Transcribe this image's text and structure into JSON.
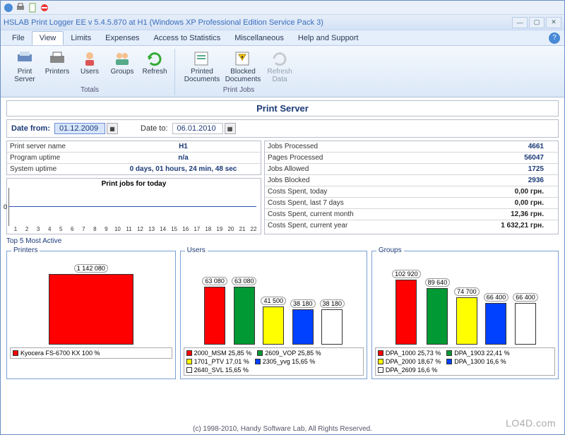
{
  "title": "HSLAB Print Logger EE v 5.4.5.870 at H1 (Windows XP Professional Edition Service Pack 3)",
  "menu": {
    "file": "File",
    "view": "View",
    "limits": "Limits",
    "expenses": "Expenses",
    "access": "Access to Statistics",
    "misc": "Miscellaneous",
    "help": "Help and Support"
  },
  "ribbon": {
    "group1": {
      "print_server": "Print Server",
      "printers": "Printers",
      "users": "Users",
      "groups": "Groups",
      "refresh": "Refresh",
      "label": "Totals"
    },
    "group2": {
      "printed_docs": "Printed Documents",
      "blocked_docs": "Blocked Documents",
      "refresh_data": "Refresh Data",
      "label": "Print Jobs"
    }
  },
  "panel_title": "Print Server",
  "dates": {
    "from_label": "Date from:",
    "from": "01.12.2009",
    "to_label": "Date to:",
    "to": "06.01.2010"
  },
  "info": {
    "server_name_k": "Print server name",
    "server_name_v": "H1",
    "prog_uptime_k": "Program uptime",
    "prog_uptime_v": "n/a",
    "sys_uptime_k": "System uptime",
    "sys_uptime_v": "0 days, 01 hours, 24 min, 48 sec"
  },
  "stats": {
    "jobs_proc_k": "Jobs Processed",
    "jobs_proc_v": "4661",
    "pages_proc_k": "Pages Processed",
    "pages_proc_v": "56047",
    "jobs_allowed_k": "Jobs Allowed",
    "jobs_allowed_v": "1725",
    "jobs_blocked_k": "Jobs Blocked",
    "jobs_blocked_v": "2936",
    "cost_today_k": "Costs Spent, today",
    "cost_today_v": "0,00 грн.",
    "cost_7d_k": "Costs Spent, last 7 days",
    "cost_7d_v": "0,00 грн.",
    "cost_month_k": "Costs Spent, current month",
    "cost_month_v": "12,36 грн.",
    "cost_year_k": "Costs Spent, current year",
    "cost_year_v": "1 632,21 грн."
  },
  "today_chart": {
    "title": "Print jobs for today",
    "ticks": [
      "1",
      "2",
      "3",
      "4",
      "5",
      "6",
      "7",
      "8",
      "9",
      "10",
      "11",
      "12",
      "13",
      "14",
      "15",
      "16",
      "17",
      "18",
      "19",
      "20",
      "21",
      "22"
    ],
    "zero": "0"
  },
  "top5_label": "Top 5 Most Active",
  "printers": {
    "legend": "Printers",
    "bars": [
      {
        "value": "1 142 080",
        "color": "#ff0000",
        "height": 100
      }
    ],
    "legend_items": [
      {
        "color": "#ff0000",
        "text": "Kyocera FS-6700 KX 100 %"
      }
    ]
  },
  "users": {
    "legend": "Users",
    "bars": [
      {
        "value": "63 080",
        "color": "#ff0000",
        "height": 82
      },
      {
        "value": "63 080",
        "color": "#009933",
        "height": 82
      },
      {
        "value": "41 500",
        "color": "#ffff00",
        "height": 54
      },
      {
        "value": "38 180",
        "color": "#0040ff",
        "height": 50
      },
      {
        "value": "38 180",
        "color": "#ffffff",
        "height": 50
      }
    ],
    "legend_items": [
      {
        "color": "#ff0000",
        "text": "2000_MSM 25,85 %"
      },
      {
        "color": "#009933",
        "text": "2609_VOP 25,85 %"
      },
      {
        "color": "#ffff00",
        "text": "1701_PTV 17,01 %"
      },
      {
        "color": "#0040ff",
        "text": "2305_yvg  15,65 %"
      },
      {
        "color": "#ffffff",
        "text": "2640_SVL  15,65 %"
      }
    ]
  },
  "groups": {
    "legend": "Groups",
    "bars": [
      {
        "value": "102 920",
        "color": "#ff0000",
        "height": 92
      },
      {
        "value": "89 640",
        "color": "#009933",
        "height": 80
      },
      {
        "value": "74 700",
        "color": "#ffff00",
        "height": 67
      },
      {
        "value": "66 400",
        "color": "#0040ff",
        "height": 59
      },
      {
        "value": "66 400",
        "color": "#ffffff",
        "height": 59
      }
    ],
    "legend_items": [
      {
        "color": "#ff0000",
        "text": "DPA_1000 25,73 %"
      },
      {
        "color": "#009933",
        "text": "DPA_1903 22,41 %"
      },
      {
        "color": "#ffff00",
        "text": "DPA_2000 18,67 %"
      },
      {
        "color": "#0040ff",
        "text": "DPA_1300  16,6 %"
      },
      {
        "color": "#ffffff",
        "text": "DPA_2609  16,6 %"
      }
    ]
  },
  "footer": "(c) 1998-2010, Handy Software Lab, All Rights Reserved.",
  "watermark": "LO4D.com",
  "chart_data": [
    {
      "type": "bar",
      "title": "Top 5 Most Active Printers",
      "categories": [
        "Kyocera FS-6700 KX"
      ],
      "values": [
        1142080
      ]
    },
    {
      "type": "bar",
      "title": "Top 5 Most Active Users",
      "categories": [
        "2000_MSM",
        "2609_VOP",
        "1701_PTV",
        "2305_yvg",
        "2640_SVL"
      ],
      "values": [
        63080,
        63080,
        41500,
        38180,
        38180
      ]
    },
    {
      "type": "bar",
      "title": "Top 5 Most Active Groups",
      "categories": [
        "DPA_1000",
        "DPA_1903",
        "DPA_2000",
        "DPA_1300",
        "DPA_2609"
      ],
      "values": [
        102920,
        89640,
        74700,
        66400,
        66400
      ]
    }
  ]
}
